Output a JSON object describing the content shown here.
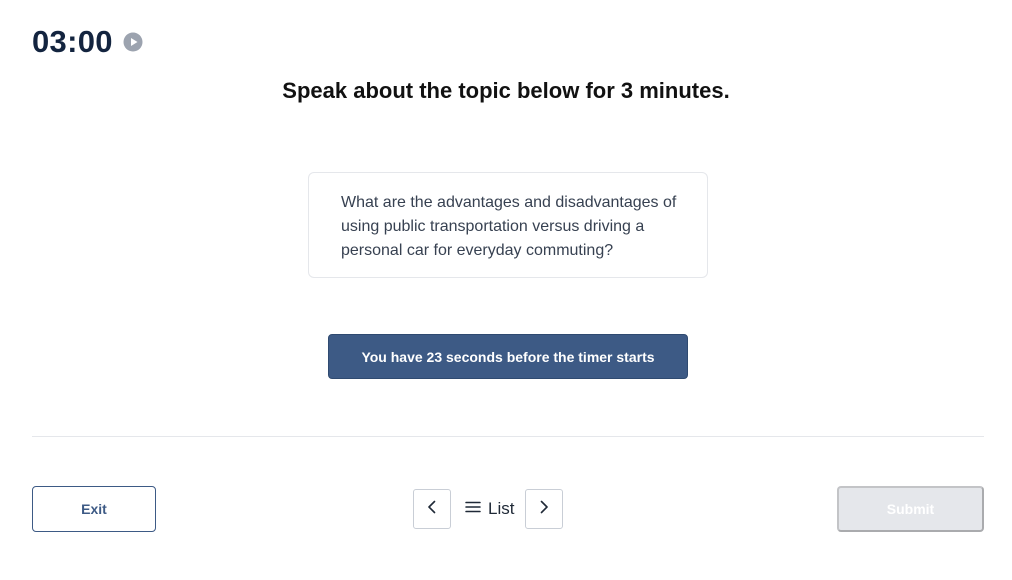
{
  "timer": {
    "value": "03:00",
    "icon": "play-circle-icon"
  },
  "heading": "Speak about the topic below for 3 minutes.",
  "prompt": {
    "text": "What are the advantages and disadvantages of using public transportation versus driving a personal car for everyday commuting?"
  },
  "status": {
    "text": "You have 23 seconds before the timer starts",
    "color": "#3d5a85"
  },
  "footer": {
    "exit_label": "Exit",
    "prev_icon": "chevron-left-icon",
    "list_icon": "hamburger-menu-icon",
    "list_label": "List",
    "next_icon": "chevron-right-icon",
    "submit_label": "Submit",
    "submit_disabled": true
  },
  "colors": {
    "accent": "#3d5a85",
    "timer": "#13243f",
    "divider": "#e5e7eb",
    "disabled": "#e5e7eb"
  }
}
